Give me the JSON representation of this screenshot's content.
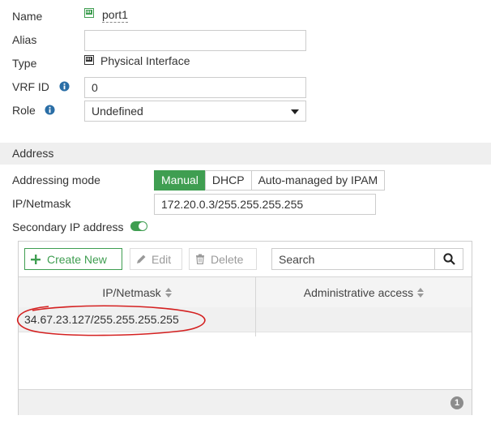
{
  "fields": {
    "name": {
      "label": "Name",
      "value": "port1"
    },
    "alias": {
      "label": "Alias",
      "value": ""
    },
    "type": {
      "label": "Type",
      "value": "Physical Interface"
    },
    "vrf_id": {
      "label": "VRF ID",
      "value": "0"
    },
    "role": {
      "label": "Role",
      "value": "Undefined"
    }
  },
  "address_section": {
    "title": "Address",
    "addressing_mode": {
      "label": "Addressing mode",
      "options": [
        "Manual",
        "DHCP",
        "Auto-managed by IPAM"
      ],
      "selected": "Manual"
    },
    "ip_netmask": {
      "label": "IP/Netmask",
      "value": "172.20.0.3/255.255.255.255"
    },
    "secondary_ip": {
      "label": "Secondary IP address",
      "enabled": true
    }
  },
  "secondary_table": {
    "toolbar": {
      "create_new": "Create New",
      "edit": "Edit",
      "delete": "Delete",
      "search_placeholder": "Search"
    },
    "columns": [
      "IP/Netmask",
      "Administrative access"
    ],
    "rows": [
      {
        "ip_netmask": "34.67.23.127/255.255.255.255",
        "admin_access": ""
      }
    ],
    "count": "1"
  },
  "colors": {
    "accent_green": "#3f9e51",
    "annotation_red": "#d42020",
    "icon_blue": "#2a6ea6"
  },
  "icons": {
    "port": "port-icon",
    "info": "info-icon",
    "plus": "plus-icon",
    "edit": "pencil-icon",
    "delete": "trash-icon",
    "search": "search-icon",
    "sort": "sort-icon"
  }
}
